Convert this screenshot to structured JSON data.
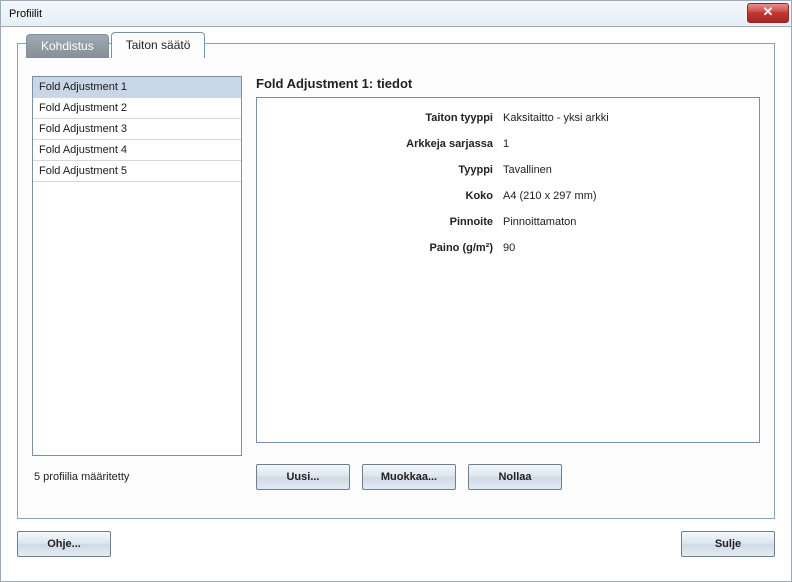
{
  "window": {
    "title": "Profiilit",
    "close_glyph": "✕"
  },
  "tabs": {
    "inactive": "Kohdistus",
    "active": "Taiton säätö"
  },
  "list": {
    "items": [
      "Fold Adjustment 1",
      "Fold Adjustment 2",
      "Fold Adjustment 3",
      "Fold Adjustment 4",
      "Fold Adjustment 5"
    ],
    "count_text": "5 profiilia määritetty"
  },
  "details": {
    "title": "Fold Adjustment 1: tiedot",
    "rows": [
      {
        "label": "Taiton tyyppi",
        "value": "Kaksitaitto - yksi arkki"
      },
      {
        "label": "Arkkeja sarjassa",
        "value": "1"
      },
      {
        "label": "Tyyppi",
        "value": "Tavallinen"
      },
      {
        "label": "Koko",
        "value": "A4 (210 x 297 mm)"
      },
      {
        "label": "Pinnoite",
        "value": "Pinnoittamaton"
      },
      {
        "label": "Paino (g/m²)",
        "value": "90"
      }
    ]
  },
  "buttons": {
    "new": "Uusi...",
    "edit": "Muokkaa...",
    "reset": "Nollaa",
    "help": "Ohje...",
    "close": "Sulje"
  }
}
